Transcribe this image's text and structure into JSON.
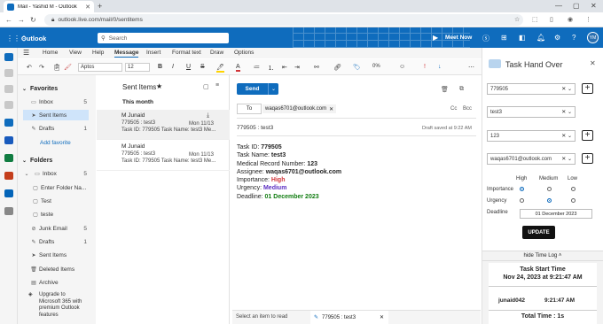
{
  "browser": {
    "tab_title": "Mail - Yashid M - Outlook",
    "url": "outlook.live.com/mail/0/sentitems"
  },
  "header": {
    "brand": "Outlook",
    "search_placeholder": "Search",
    "meet_now": "Meet Now",
    "avatar": "YM"
  },
  "ribbon": {
    "tabs": [
      "Home",
      "View",
      "Help",
      "Message",
      "Insert",
      "Format text",
      "Draw",
      "Options"
    ],
    "active_tab": "Message",
    "font_name": "Aptos",
    "font_size": "12",
    "zoom": "0%"
  },
  "folders": {
    "favorites_label": "Favorites",
    "fav_items": [
      {
        "label": "Inbox",
        "count": "5"
      },
      {
        "label": "Sent Items",
        "count": ""
      },
      {
        "label": "Drafts",
        "count": "1"
      }
    ],
    "add_favorite": "Add favorite",
    "folders_label": "Folders",
    "items": [
      {
        "label": "Inbox",
        "count": "5"
      },
      {
        "label": "Enter Folder Na...",
        "count": ""
      },
      {
        "label": "Test",
        "count": ""
      },
      {
        "label": "teste",
        "count": ""
      },
      {
        "label": "Junk Email",
        "count": "5"
      },
      {
        "label": "Drafts",
        "count": "1"
      },
      {
        "label": "Sent Items",
        "count": ""
      },
      {
        "label": "Deleted Items",
        "count": ""
      },
      {
        "label": "Archive",
        "count": ""
      }
    ],
    "upgrade_l1": "Upgrade to",
    "upgrade_l2": "Microsoft 365 with",
    "upgrade_l3": "premium Outlook",
    "upgrade_l4": "features"
  },
  "message_list": {
    "title": "Sent Items",
    "group": "This month",
    "items": [
      {
        "from": "M Junaid",
        "subject": "779505 : test3",
        "date": "Mon 11/13",
        "preview": "Task ID: 779505 Task Name: test3 Me..."
      },
      {
        "from": "M Junaid",
        "subject": "779505 : test3",
        "date": "Mon 11/13",
        "preview": "Task ID: 779505 Task Name: test3 Me..."
      }
    ]
  },
  "compose": {
    "send": "Send",
    "to_label": "To",
    "to_value": "waqas6701@outlook.com",
    "cc": "Cc",
    "bcc": "Bcc",
    "subject": "779505 : test3",
    "draft_saved": "Draft saved at 9:22 AM",
    "body": {
      "task_id_label": "Task ID:",
      "task_id": "779505",
      "task_name_label": "Task Name:",
      "task_name": "test3",
      "mrn_label": "Medical Record Number:",
      "mrn": "123",
      "assignee_label": "Assignee:",
      "assignee": "waqas6701@outlook.com",
      "importance_label": "Importance:",
      "importance": "High",
      "urgency_label": "Urgency:",
      "urgency": "Medium",
      "deadline_label": "Deadline:",
      "deadline": "01 December 2023"
    }
  },
  "status_bar": {
    "select_item": "Select an item to read",
    "draft_tab": "779505 : test3"
  },
  "task_panel": {
    "title": "Task Hand Over",
    "task_id": "779505",
    "task_name": "test3",
    "mrn": "123",
    "assignee": "waqas6701@outlook.com",
    "levels": [
      "High",
      "Medium",
      "Low"
    ],
    "importance_label": "Importance",
    "urgency_label": "Urgency",
    "deadline_label": "Deadline",
    "deadline_value": "01 December 2023",
    "update_button": "UPDATE",
    "hide_time_log": "hide Time Log",
    "task_start_label": "Task Start Time",
    "task_start_value": "Nov 24, 2023 at 9:21:47 AM",
    "log_user": "junaid042",
    "log_time": "9:21:47 AM",
    "total_time": "Total Time : 1s"
  },
  "colors": {
    "brand_blue": "#0f6cbd",
    "importance_high": "#d13438",
    "urgency_medium": "#5b2ec2",
    "deadline_green": "#107c10"
  }
}
